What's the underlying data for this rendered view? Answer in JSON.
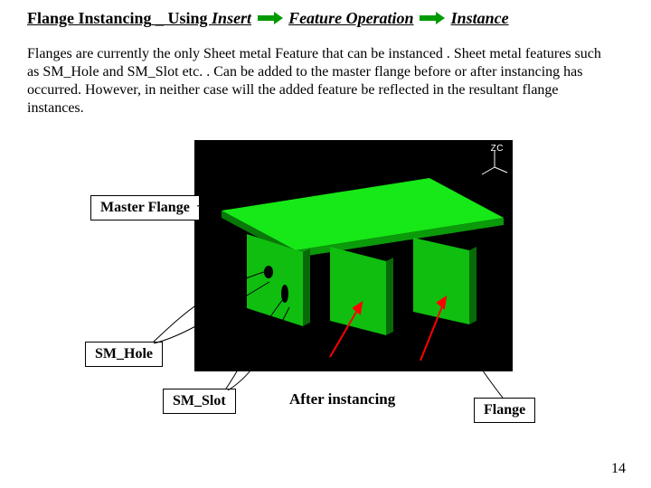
{
  "title": {
    "prefix": "Flange Instancing",
    "sep": " _ ",
    "using": "Using ",
    "step1": "Insert",
    "step2": "Feature Operation",
    "step3": "Instance"
  },
  "body": "Flanges are currently the only Sheet metal Feature that can be instanced . Sheet metal features such as SM_Hole and SM_Slot etc. . Can be added to the master flange before or after instancing has occurred. However, in neither case will the added feature be reflected in the resultant flange instances.",
  "triad": "ZC",
  "labels": {
    "master": "Master Flange",
    "hole": "SM_Hole",
    "slot": "SM_Slot",
    "after": "After instancing",
    "flange": "Flange"
  },
  "page": "14",
  "colors": {
    "arrow": "#009a00",
    "callout_red": "#ff0000",
    "part_green_light": "#17e817",
    "part_green_mid": "#0fbe0f",
    "part_green_dark": "#087808"
  }
}
